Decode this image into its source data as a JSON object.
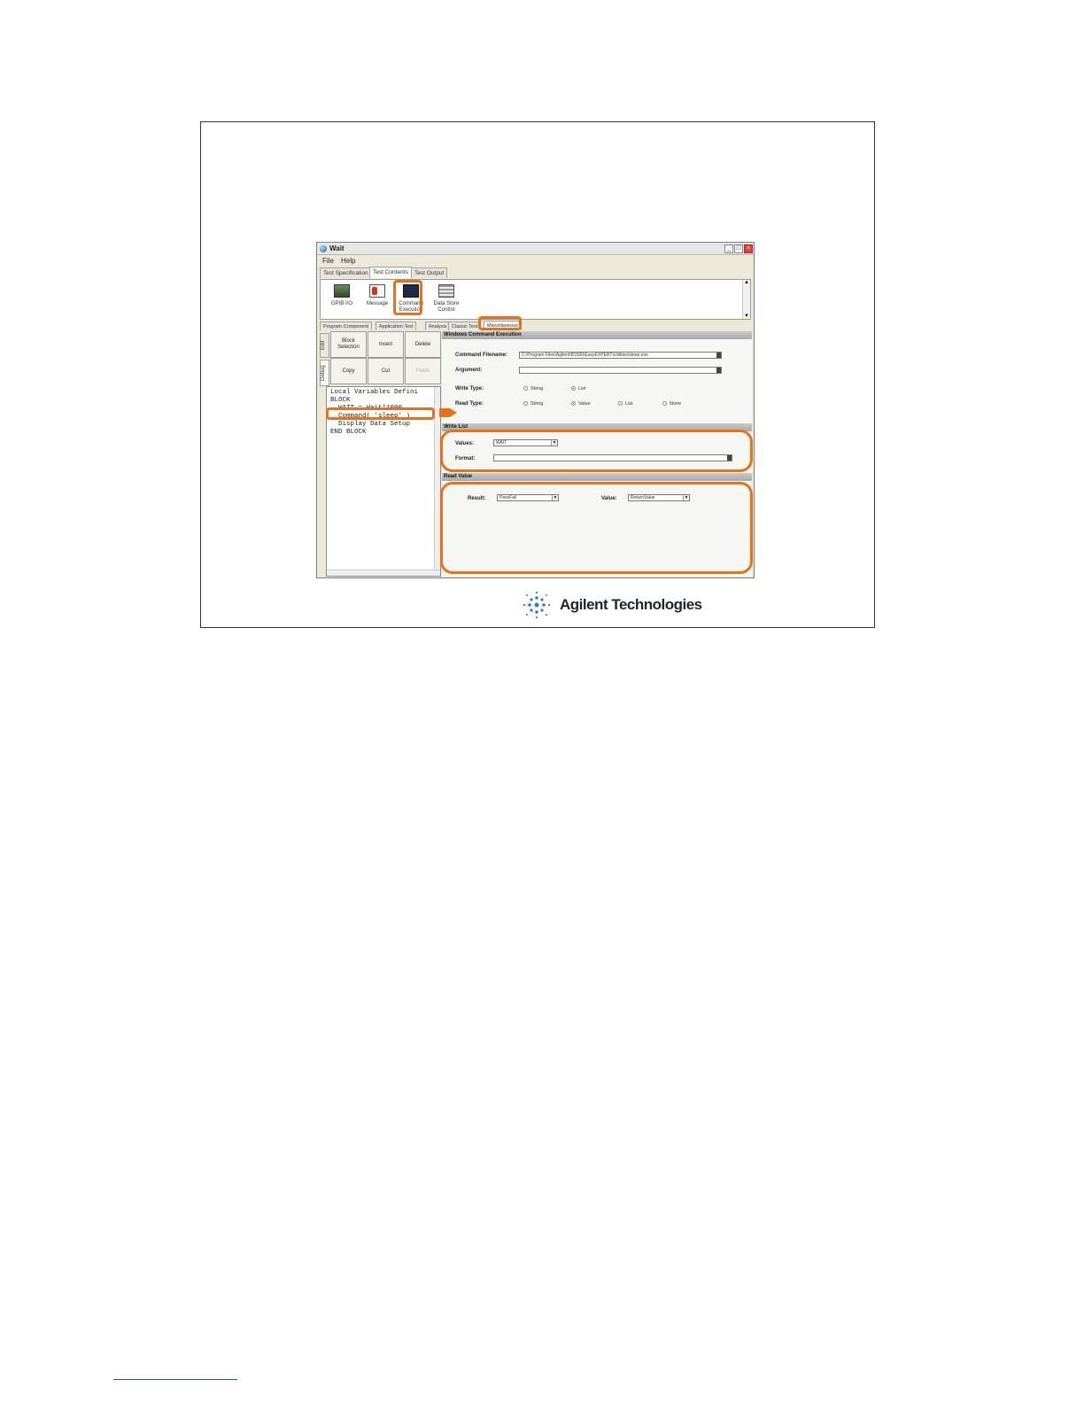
{
  "window": {
    "title": "Wait",
    "controls": {
      "minimize": "_",
      "maximize": "□",
      "close": "×"
    }
  },
  "menu": {
    "file": "File",
    "help": "Help"
  },
  "top_tabs": [
    {
      "label": "Test Specification",
      "active": false
    },
    {
      "label": "Test Contents",
      "active": true
    },
    {
      "label": "Test Output",
      "active": false
    }
  ],
  "toolbox": {
    "tools": [
      {
        "label": "GPIB I/O",
        "icon": "gpib-icon"
      },
      {
        "label": "Message",
        "icon": "message-icon"
      },
      {
        "label": "Command Execution",
        "icon": "command-execution-icon"
      },
      {
        "label": "Data Store Control",
        "icon": "data-store-icon"
      }
    ],
    "scroll_up": "▲",
    "scroll_down": "▼"
  },
  "sub_tabs": [
    {
      "label": "Program Component",
      "active": false
    },
    {
      "label": "Application Test",
      "active": false
    },
    {
      "label": "Analysis",
      "active": false
    },
    {
      "label": "Classic Test",
      "active": false
    },
    {
      "label": "Miscellaneous",
      "active": true
    }
  ],
  "side_tabs": {
    "edit": "Edit",
    "debug": "Debug"
  },
  "edit_buttons": {
    "block_selection": "Block Selection",
    "insert": "Insert",
    "delete": "Delete",
    "copy": "Copy",
    "cut": "Cut",
    "paste": "Paste"
  },
  "code_lines": [
    "Local Variables Defini",
    "BLOCK",
    "  WAIT = Wait*1000",
    "  Command( 'sleep' )",
    "  Display Data Setup",
    "END BLOCK"
  ],
  "command_execution": {
    "header": "Windows Command Execution",
    "filename_label": "Command Filename:",
    "filename_value": "C:\\Program Files\\Agilent\\B1500\\EasyEXPERT\\Utilities\\sleep.exe",
    "argument_label": "Argument:",
    "argument_value": "",
    "write_type_label": "Write Type:",
    "write_type_options": [
      "String",
      "List"
    ],
    "read_type_label": "Read Type:",
    "read_type_options": [
      "String",
      "Value",
      "List",
      "None"
    ]
  },
  "write_list": {
    "header": "Write List",
    "values_label": "Values:",
    "values_value": "WAIT",
    "format_label": "Format:",
    "format_value": ""
  },
  "read_value": {
    "header": "Read Value",
    "result_label": "Result:",
    "result_value": "PassFail",
    "value_label": "Value:",
    "value_value": "ReturnValue"
  },
  "logo": {
    "text": "Agilent Technologies"
  },
  "colors": {
    "highlight": "#e8711c",
    "window_bg": "#ece9d8",
    "header_bg": "#b8b8b8"
  }
}
